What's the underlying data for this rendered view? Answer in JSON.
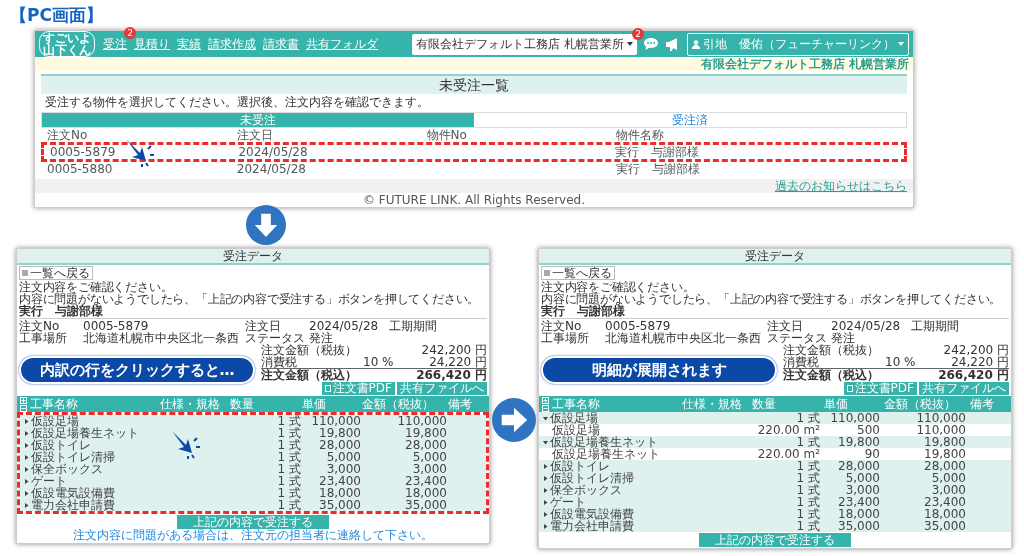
{
  "page_title": "【PC画面】",
  "list_screen": {
    "logo_lines": [
      "すごいよ",
      "山下くん"
    ],
    "nav": [
      {
        "label": "受注",
        "badge": "2"
      },
      {
        "label": "見積り"
      },
      {
        "label": "実績"
      },
      {
        "label": "請求作成"
      },
      {
        "label": "請求書"
      },
      {
        "label": "共有フォルダ"
      }
    ],
    "company_select": "有限会社デフォルト工務店 札幌営業所",
    "chat_badge": "2",
    "user": "引地　優佑（フューチャーリンク）",
    "company_band": "有限会社デフォルト工務店 札幌営業所",
    "title": "未受注一覧",
    "instruction": "受注する物件を選択してください。選択後、注文内容を確認できます。",
    "tabs": [
      {
        "label": "未受注",
        "selected": true
      },
      {
        "label": "受注済",
        "selected": false
      }
    ],
    "columns": [
      "注文No",
      "注文日",
      "物件No",
      "物件名称"
    ],
    "rows": [
      {
        "order_no": "0005-5879",
        "date": "2024/05/28",
        "name": "実行　与謝部様",
        "highlighted": true
      },
      {
        "order_no": "0005-5880",
        "date": "2024/05/28",
        "name": "実行　与謝部様",
        "highlighted": false
      }
    ],
    "footer_link": "過去のお知らせはこちら",
    "copyright": "© FUTURE LINK. All Rights Reserved."
  },
  "detail_screens": [
    {
      "callout": "内訳の行をクリックすると…",
      "title": "受注データ",
      "back_button": "一覧へ戻る",
      "instructions": [
        "注文内容をご確認ください。",
        "内容に問題がないようでしたら、「上記の内容で受注する」ボタンを押してください。"
      ],
      "heading": "実行　与謝部様",
      "info": [
        {
          "label": "注文No",
          "value": "0005-5879"
        },
        {
          "label": "注文日",
          "value": "2024/05/28"
        },
        {
          "label": "工期期間"
        },
        {
          "label": "工事場所",
          "value": "北海道札幌市中央区北一条西"
        },
        {
          "label": "ステータス",
          "value": "発注"
        }
      ],
      "totals": [
        {
          "label": "注文金額（税抜）",
          "value": "242,200 円"
        },
        {
          "label": "消費税",
          "rate": "10 %",
          "value": "24,220 円"
        },
        {
          "label": "注文金額（税込）",
          "value": "266,420 円"
        }
      ],
      "buttons": [
        "注文書PDF",
        "共有ファイルへ"
      ],
      "columns": [
        "工事名称",
        "仕様・規格",
        "数量",
        "単価",
        "金額（税抜）",
        "備考"
      ],
      "rows_highlighted": true,
      "rows": [
        {
          "name": "仮設足場",
          "quantity": "1 式",
          "unit_price": "110,000",
          "amount": "110,000",
          "expanded": false
        },
        {
          "name": "仮設足場養生ネット",
          "quantity": "1 式",
          "unit_price": "19,800",
          "amount": "19,800",
          "expanded": false
        },
        {
          "name": "仮設トイレ",
          "quantity": "1 式",
          "unit_price": "28,000",
          "amount": "28,000",
          "expanded": false
        },
        {
          "name": "仮設トイレ清掃",
          "quantity": "1 式",
          "unit_price": "5,000",
          "amount": "5,000",
          "expanded": false
        },
        {
          "name": "保全ボックス",
          "quantity": "1 式",
          "unit_price": "3,000",
          "amount": "3,000",
          "expanded": false
        },
        {
          "name": "ゲート",
          "quantity": "1 式",
          "unit_price": "23,400",
          "amount": "23,400",
          "expanded": false
        },
        {
          "name": "仮設電気設備費",
          "quantity": "1 式",
          "unit_price": "18,000",
          "amount": "18,000",
          "expanded": false
        },
        {
          "name": "電力会社申請費",
          "quantity": "1 式",
          "unit_price": "35,000",
          "amount": "35,000",
          "expanded": false
        }
      ],
      "accept_button": "上記の内容で受注する",
      "note": "注文内容に問題がある場合は、注文元の担当者に連絡して下さい。"
    },
    {
      "callout": "明細が展開されます",
      "title": "受注データ",
      "back_button": "一覧へ戻る",
      "instructions": [
        "注文内容をご確認ください。",
        "内容に問題がないようでしたら、「上記の内容で受注する」ボタンを押してください。"
      ],
      "heading": "実行　与謝部様",
      "info": [
        {
          "label": "注文No",
          "value": "0005-5879"
        },
        {
          "label": "注文日",
          "value": "2024/05/28"
        },
        {
          "label": "工期期間"
        },
        {
          "label": "工事場所",
          "value": "北海道札幌市中央区北一条西"
        },
        {
          "label": "ステータス",
          "value": "発注"
        }
      ],
      "totals": [
        {
          "label": "注文金額（税抜）",
          "value": "242,200 円"
        },
        {
          "label": "消費税",
          "rate": "10 %",
          "value": "24,220 円"
        },
        {
          "label": "注文金額（税込）",
          "value": "266,420 円"
        }
      ],
      "buttons": [
        "注文書PDF",
        "共有ファイルへ"
      ],
      "columns": [
        "工事名称",
        "仕様・規格",
        "数量",
        "単価",
        "金額（税抜）",
        "備考"
      ],
      "rows_highlighted": false,
      "rows": [
        {
          "name": "仮設足場",
          "quantity": "1 式",
          "unit_price": "110,000",
          "amount": "110,000",
          "expanded": true,
          "children": [
            {
              "name": "仮設足場",
              "quantity": "220.00 m²",
              "unit_price": "500",
              "amount": "110,000"
            }
          ]
        },
        {
          "name": "仮設足場養生ネット",
          "quantity": "1 式",
          "unit_price": "19,800",
          "amount": "19,800",
          "expanded": true,
          "children": [
            {
              "name": "仮設足場養生ネット",
              "quantity": "220.00 m²",
              "unit_price": "90",
              "amount": "19,800"
            }
          ]
        },
        {
          "name": "仮設トイレ",
          "quantity": "1 式",
          "unit_price": "28,000",
          "amount": "28,000",
          "expanded": false
        },
        {
          "name": "仮設トイレ清掃",
          "quantity": "1 式",
          "unit_price": "5,000",
          "amount": "5,000",
          "expanded": false
        },
        {
          "name": "保全ボックス",
          "quantity": "1 式",
          "unit_price": "3,000",
          "amount": "3,000",
          "expanded": false
        },
        {
          "name": "ゲート",
          "quantity": "1 式",
          "unit_price": "23,400",
          "amount": "23,400",
          "expanded": false
        },
        {
          "name": "仮設電気設備費",
          "quantity": "1 式",
          "unit_price": "18,000",
          "amount": "18,000",
          "expanded": false
        },
        {
          "name": "電力会社申請費",
          "quantity": "1 式",
          "unit_price": "35,000",
          "amount": "35,000",
          "expanded": false
        }
      ],
      "accept_button": "上記の内容で受注する"
    }
  ]
}
